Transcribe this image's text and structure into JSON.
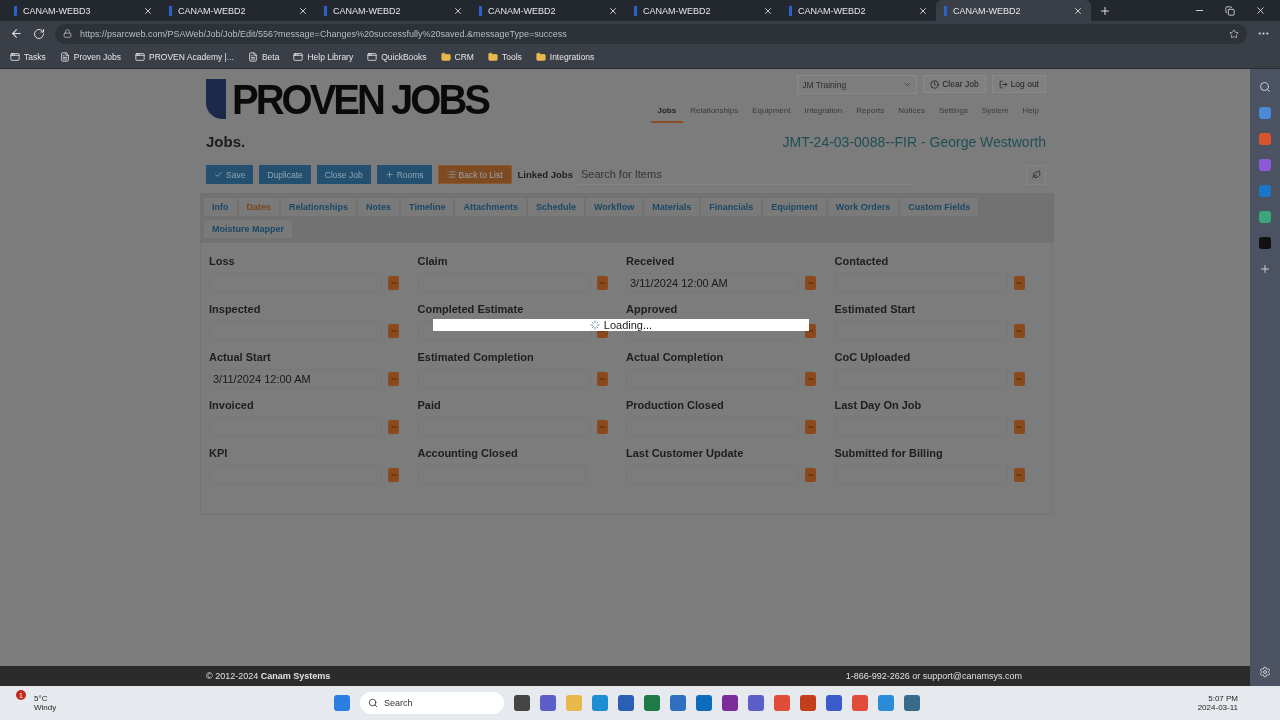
{
  "browser": {
    "tabs": [
      {
        "title": "CANAM-WEBD3",
        "selected": false
      },
      {
        "title": "CANAM-WEBD2",
        "selected": false
      },
      {
        "title": "CANAM-WEBD2",
        "selected": false
      },
      {
        "title": "CANAM-WEBD2",
        "selected": false
      },
      {
        "title": "CANAM-WEBD2",
        "selected": false
      },
      {
        "title": "CANAM-WEBD2",
        "selected": false
      },
      {
        "title": "CANAM-WEBD2",
        "selected": true
      }
    ],
    "url": "https://psarcweb.com/PSAWeb/Job/Job/Edit/556?message=Changes%20successfully%20saved.&messageType=success",
    "bookmarks": [
      {
        "label": "Tasks",
        "kind": "app"
      },
      {
        "label": "Proven Jobs",
        "kind": "page"
      },
      {
        "label": "PROVEN Academy |...",
        "kind": "app"
      },
      {
        "label": "Beta",
        "kind": "page"
      },
      {
        "label": "Help Library",
        "kind": "app"
      },
      {
        "label": "QuickBooks",
        "kind": "app"
      },
      {
        "label": "CRM",
        "kind": "folder"
      },
      {
        "label": "Tools",
        "kind": "folder"
      },
      {
        "label": "Integrations",
        "kind": "folder"
      }
    ]
  },
  "header": {
    "logo": "PROVEN JOBS",
    "company_select": "JM Training",
    "actions": [
      {
        "label": "Clear Job",
        "kind": "clear"
      },
      {
        "label": "Log out",
        "kind": "logout"
      }
    ],
    "nav": [
      {
        "label": "Jobs",
        "selected": true
      },
      {
        "label": "Relationships",
        "selected": false
      },
      {
        "label": "Equipment",
        "selected": false
      },
      {
        "label": "Integration",
        "selected": false
      },
      {
        "label": "Reports",
        "selected": false
      },
      {
        "label": "Notices",
        "selected": false
      },
      {
        "label": "Settings",
        "selected": false
      },
      {
        "label": "System",
        "selected": false
      },
      {
        "label": "Help",
        "selected": false
      }
    ]
  },
  "page_title": "Jobs.",
  "job_title": "JMT-24-03-0088--FIR - George Westworth",
  "toolbar": {
    "buttons": [
      {
        "label": "Save",
        "kind": "save"
      },
      {
        "label": "Duplicate",
        "kind": "plain"
      },
      {
        "label": "Close Job",
        "kind": "plain"
      },
      {
        "label": "Rooms",
        "kind": "add"
      },
      {
        "label": "Back to List",
        "kind": "list"
      }
    ],
    "linked_label": "Linked Jobs",
    "search_placeholder": "Search for Items"
  },
  "tabs": [
    {
      "label": "Info",
      "selected": false
    },
    {
      "label": "Dates",
      "selected": true
    },
    {
      "label": "Relationships",
      "selected": false
    },
    {
      "label": "Notes",
      "selected": false
    },
    {
      "label": "Timeline",
      "selected": false
    },
    {
      "label": "Attachments",
      "selected": false
    },
    {
      "label": "Schedule",
      "selected": false
    },
    {
      "label": "Workflow",
      "selected": false
    },
    {
      "label": "Materials",
      "selected": false
    },
    {
      "label": "Financials",
      "selected": false
    },
    {
      "label": "Equipment",
      "selected": false
    },
    {
      "label": "Work Orders",
      "selected": false
    },
    {
      "label": "Custom Fields",
      "selected": false
    },
    {
      "label": "Moisture Mapper",
      "selected": false
    }
  ],
  "fields": [
    {
      "label": "Loss",
      "picker": true
    },
    {
      "label": "Claim",
      "picker": true
    },
    {
      "label": "Received",
      "value": "3/11/2024 12:00 AM",
      "picker": true
    },
    {
      "label": "Contacted",
      "picker": true
    },
    {
      "label": "Inspected",
      "picker": true
    },
    {
      "label": "Completed Estimate",
      "picker": true
    },
    {
      "label": "Approved",
      "picker": true
    },
    {
      "label": "Estimated Start",
      "picker": true
    },
    {
      "label": "Actual Start",
      "value": "3/11/2024 12:00 AM",
      "picker": true
    },
    {
      "label": "Estimated Completion",
      "picker": true
    },
    {
      "label": "Actual Completion",
      "picker": true
    },
    {
      "label": "CoC Uploaded",
      "picker": true
    },
    {
      "label": "Invoiced",
      "picker": true
    },
    {
      "label": "Paid",
      "picker": true
    },
    {
      "label": "Production Closed",
      "picker": true
    },
    {
      "label": "Last Day On Job",
      "picker": true
    },
    {
      "label": "KPI",
      "picker": true
    },
    {
      "label": "Accounting Closed",
      "picker": false
    },
    {
      "label": "Last Customer Update",
      "picker": true
    },
    {
      "label": "Submitted for Billing",
      "picker": true
    }
  ],
  "loading": "Loading...",
  "footer": {
    "copyright": "© 2012-2024 **Canam Systems**",
    "contact": "1-866-992-2626 or support@canamsys.com"
  },
  "taskbar": {
    "temperature": "5°C",
    "weather": "Windy",
    "badge": "1",
    "search": "Search",
    "time": "5:07 PM",
    "date": "2024-03-11"
  }
}
